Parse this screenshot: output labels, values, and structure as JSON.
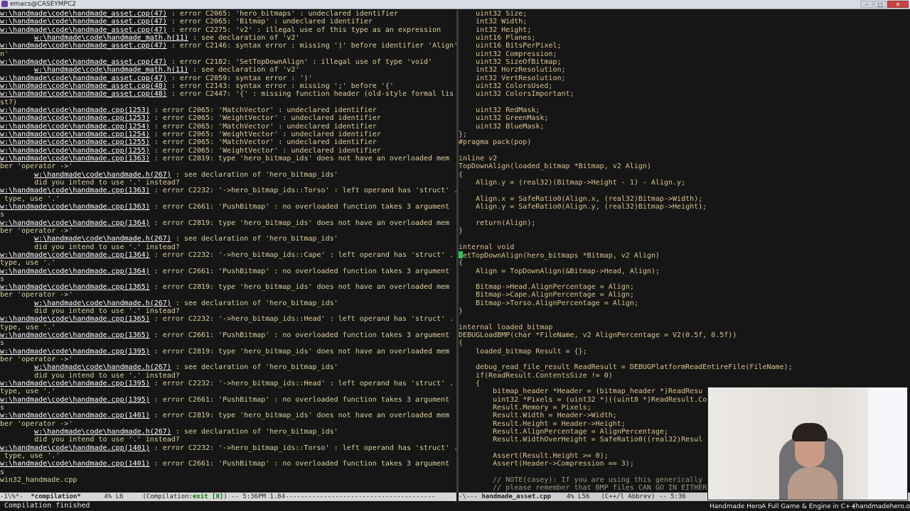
{
  "window": {
    "title": "emacs@CASEYMPC2",
    "min": "–",
    "max": "□",
    "close": "✕"
  },
  "compilation": {
    "lines": [
      {
        "p": "w:\\handmade\\code\\handmade_asset.cpp(47)",
        "t": " : error C2065: 'hero_bitmaps' : undeclared identifier"
      },
      {
        "p": "w:\\handmade\\code\\handmade_asset.cpp(47)",
        "t": " : error C2065: 'Bitmap' : undeclared identifier"
      },
      {
        "p": "w:\\handmade\\code\\handmade_asset.cpp(47)",
        "t": " : error C2275: 'v2' : illegal use of this type as an expression"
      },
      {
        "i": "        ",
        "p": "w:\\handmade\\code\\handmade_math.h(11)",
        "t": " : see declaration of 'v2'"
      },
      {
        "p": "w:\\handmade\\code\\handmade_asset.cpp(47)",
        "t": " : error C2146: syntax error : missing ')' before identifier 'Align'"
      },
      {
        "t": "n'"
      },
      {
        "p": "w:\\handmade\\code\\handmade_asset.cpp(47)",
        "t": " : error C2182: 'SetTopDownAlign' : illegal use of type 'void'"
      },
      {
        "i": "        ",
        "p": "w:\\handmade\\code\\handmade_math.h(11)",
        "t": " : see declaration of 'v2'"
      },
      {
        "p": "w:\\handmade\\code\\handmade_asset.cpp(47)",
        "t": " : error C2059: syntax error : ')'"
      },
      {
        "p": "w:\\handmade\\code\\handmade_asset.cpp(48)",
        "t": " : error C2143: syntax error : missing ';' before '{'"
      },
      {
        "p": "w:\\handmade\\code\\handmade_asset.cpp(48)",
        "t": " : error C2447: '{' : missing function header (old-style formal lis"
      },
      {
        "t": "st?)"
      },
      {
        "p": "w:\\handmade\\code\\handmade.cpp(1253)",
        "t": " : error C2065: 'MatchVector' : undeclared identifier"
      },
      {
        "p": "w:\\handmade\\code\\handmade.cpp(1253)",
        "t": " : error C2065: 'WeightVector' : undeclared identifier"
      },
      {
        "p": "w:\\handmade\\code\\handmade.cpp(1254)",
        "t": " : error C2065: 'MatchVector' : undeclared identifier"
      },
      {
        "p": "w:\\handmade\\code\\handmade.cpp(1254)",
        "t": " : error C2065: 'WeightVector' : undeclared identifier"
      },
      {
        "p": "w:\\handmade\\code\\handmade.cpp(1255)",
        "t": " : error C2065: 'MatchVector' : undeclared identifier"
      },
      {
        "p": "w:\\handmade\\code\\handmade.cpp(1255)",
        "t": " : error C2065: 'WeightVector' : undeclared identifier"
      },
      {
        "p": "w:\\handmade\\code\\handmade.cpp(1363)",
        "t": " : error C2819: type 'hero_bitmap_ids' does not have an overloaded mem"
      },
      {
        "t": "ber 'operator ->'"
      },
      {
        "i": "        ",
        "p": "w:\\handmade\\code\\handmade.h(267)",
        "t": " : see declaration of 'hero_bitmap_ids'"
      },
      {
        "t": "        did you intend to use '.' instead?"
      },
      {
        "p": "w:\\handmade\\code\\handmade.cpp(1363)",
        "t": " : error C2232: '->hero_bitmap_ids::Torso' : left operand has 'struct' ."
      },
      {
        "t": " type, use '.'"
      },
      {
        "p": "w:\\handmade\\code\\handmade.cpp(1363)",
        "t": " : error C2661: 'PushBitmap' : no overloaded function takes 3 argument"
      },
      {
        "t": "s"
      },
      {
        "p": "w:\\handmade\\code\\handmade.cpp(1364)",
        "t": " : error C2819: type 'hero_bitmap_ids' does not have an overloaded mem"
      },
      {
        "t": "ber 'operator ->'"
      },
      {
        "i": "        ",
        "p": "w:\\handmade\\code\\handmade.h(267)",
        "t": " : see declaration of 'hero_bitmap_ids'"
      },
      {
        "t": "        did you intend to use '.' instead?"
      },
      {
        "p": "w:\\handmade\\code\\handmade.cpp(1364)",
        "t": " : error C2232: '->hero_bitmap_ids::Cape' : left operand has 'struct' ."
      },
      {
        "t": "type, use '.'"
      },
      {
        "p": "w:\\handmade\\code\\handmade.cpp(1364)",
        "t": " : error C2661: 'PushBitmap' : no overloaded function takes 3 argument"
      },
      {
        "t": "s"
      },
      {
        "p": "w:\\handmade\\code\\handmade.cpp(1365)",
        "t": " : error C2819: type 'hero_bitmap_ids' does not have an overloaded mem"
      },
      {
        "t": "ber 'operator ->'"
      },
      {
        "i": "        ",
        "p": "w:\\handmade\\code\\handmade.h(267)",
        "t": " : see declaration of 'hero_bitmap_ids'"
      },
      {
        "t": "        did you intend to use '.' instead?"
      },
      {
        "p": "w:\\handmade\\code\\handmade.cpp(1365)",
        "t": " : error C2232: '->hero_bitmap_ids::Head' : left operand has 'struct' ."
      },
      {
        "t": "type, use '.'"
      },
      {
        "p": "w:\\handmade\\code\\handmade.cpp(1365)",
        "t": " : error C2661: 'PushBitmap' : no overloaded function takes 3 argument"
      },
      {
        "t": "s"
      },
      {
        "p": "w:\\handmade\\code\\handmade.cpp(1395)",
        "t": " : error C2819: type 'hero_bitmap_ids' does not have an overloaded mem"
      },
      {
        "t": "ber 'operator ->'"
      },
      {
        "i": "        ",
        "p": "w:\\handmade\\code\\handmade.h(267)",
        "t": " : see declaration of 'hero_bitmap_ids'"
      },
      {
        "t": "        did you intend to use '.' instead?"
      },
      {
        "p": "w:\\handmade\\code\\handmade.cpp(1395)",
        "t": " : error C2232: '->hero_bitmap_ids::Head' : left operand has 'struct' ."
      },
      {
        "t": "type, use '.'"
      },
      {
        "p": "w:\\handmade\\code\\handmade.cpp(1395)",
        "t": " : error C2661: 'PushBitmap' : no overloaded function takes 3 argument"
      },
      {
        "t": "s"
      },
      {
        "p": "w:\\handmade\\code\\handmade.cpp(1401)",
        "t": " : error C2819: type 'hero_bitmap_ids' does not have an overloaded mem"
      },
      {
        "t": "ber 'operator ->'"
      },
      {
        "i": "        ",
        "p": "w:\\handmade\\code\\handmade.h(267)",
        "t": " : see declaration of 'hero_bitmap_ids'"
      },
      {
        "t": "        did you intend to use '.' instead?"
      },
      {
        "p": "w:\\handmade\\code\\handmade.cpp(1401)",
        "t": " : error C2232: '->hero_bitmap_ids::Torso' : left operand has 'struct' ."
      },
      {
        "t": " type, use '.'"
      },
      {
        "p": "w:\\handmade\\code\\handmade.cpp(1401)",
        "t": " : error C2661: 'PushBitmap' : no overloaded function takes 3 argument"
      },
      {
        "t": "s"
      },
      {
        "t": "win32_handmade.cpp"
      }
    ]
  },
  "code": {
    "lines": [
      {
        "t": "    uint32 Size;"
      },
      {
        "t": "    int32 Width;"
      },
      {
        "t": "    int32 Height;"
      },
      {
        "t": "    uint16 Planes;"
      },
      {
        "t": "    uint16 BitsPerPixel;"
      },
      {
        "t": "    uint32 Compression;"
      },
      {
        "t": "    uint32 SizeOfBitmap;"
      },
      {
        "t": "    int32 HorzResolution;"
      },
      {
        "t": "    int32 VertResolution;"
      },
      {
        "t": "    uint32 ColorsUsed;"
      },
      {
        "t": "    uint32 ColorsImportant;"
      },
      {
        "t": ""
      },
      {
        "t": "    uint32 RedMask;"
      },
      {
        "t": "    uint32 GreenMask;"
      },
      {
        "t": "    uint32 BlueMask;"
      },
      {
        "t": "};"
      },
      {
        "t": "#pragma pack(pop)"
      },
      {
        "t": ""
      },
      {
        "t": "inline v2"
      },
      {
        "t": "TopDownAlign(loaded_bitmap *Bitmap, v2 Align)"
      },
      {
        "t": "{"
      },
      {
        "t": "    Align.y = (real32)(Bitmap->Height - 1) - Align.y;"
      },
      {
        "t": ""
      },
      {
        "t": "    Align.x = SafeRatio0(Align.x, (real32)Bitmap->Width);"
      },
      {
        "t": "    Align.y = SafeRatio0(Align.y, (real32)Bitmap->Height);"
      },
      {
        "t": ""
      },
      {
        "t": "    return(Align);"
      },
      {
        "t": "}"
      },
      {
        "t": ""
      },
      {
        "t": "internal void"
      },
      {
        "t": "etTopDownAlign(hero_bitmaps *Bitmap, v2 Align)",
        "cursor": true
      },
      {
        "t": "{"
      },
      {
        "t": "    Align = TopDownAlign(&Bitmap->Head, Align);"
      },
      {
        "t": ""
      },
      {
        "t": "    Bitmap->Head.AlignPercentage = Align;"
      },
      {
        "t": "    Bitmap->Cape.AlignPercentage = Align;"
      },
      {
        "t": "    Bitmap->Torso.AlignPercentage = Align;"
      },
      {
        "t": "}"
      },
      {
        "t": ""
      },
      {
        "t": "internal loaded_bitmap"
      },
      {
        "t": "DEBUGLoadBMP(char *FileName, v2 AlignPercentage = V2(0.5f, 0.5f))"
      },
      {
        "t": "{"
      },
      {
        "t": "    loaded_bitmap Result = {};"
      },
      {
        "t": ""
      },
      {
        "t": "    debug_read_file_result ReadResult = DEBUGPlatformReadEntireFile(FileName);"
      },
      {
        "t": "    if(ReadResult.ContentsSize != 0)"
      },
      {
        "t": "    {"
      },
      {
        "t": "        bitmap_header *Header = (bitmap_header *)ReadResu"
      },
      {
        "t": "        uint32 *Pixels = (uint32 *)((uint8 *)ReadResult.Co"
      },
      {
        "t": "        Result.Memory = Pixels;"
      },
      {
        "t": "        Result.Width = Header->Width;"
      },
      {
        "t": "        Result.Height = Header->Height;"
      },
      {
        "t": "        Result.AlignPercentage = AlignPercentage;"
      },
      {
        "t": "        Result.WidthOverHeight = SafeRatio0((real32)Resul"
      },
      {
        "t": ""
      },
      {
        "t": "        Assert(Result.Height >= 0);"
      },
      {
        "t": "        Assert(Header->Compression == 3);"
      },
      {
        "t": ""
      },
      {
        "t": "        // NOTE(casey): If you are using this generically",
        "comment": true
      },
      {
        "t": "        // please remember that BMP files CAN GO IN EITHER",
        "comment": true
      }
    ]
  },
  "modeline_left": {
    "prefix": "-1\\%*-  ",
    "buffer": "*compilation*",
    "pos": "      4% L6     ",
    "mode_open": "(Compilation:",
    "mode_exit": "exit [0]",
    "mode_close": ") -- 5:36PM 1.84---------------------------------------"
  },
  "modeline_right": {
    "prefix": "-\\--- ",
    "buffer": "handmade_asset.cpp",
    "rest": "    4% L56   (C++/l Abbrev) -- 5:36"
  },
  "echo": "Compilation finished",
  "overlay": {
    "left": "Handmade Hero",
    "mid": "A Full Game & Engine in C++",
    "right": "(handmadehero.org)"
  }
}
